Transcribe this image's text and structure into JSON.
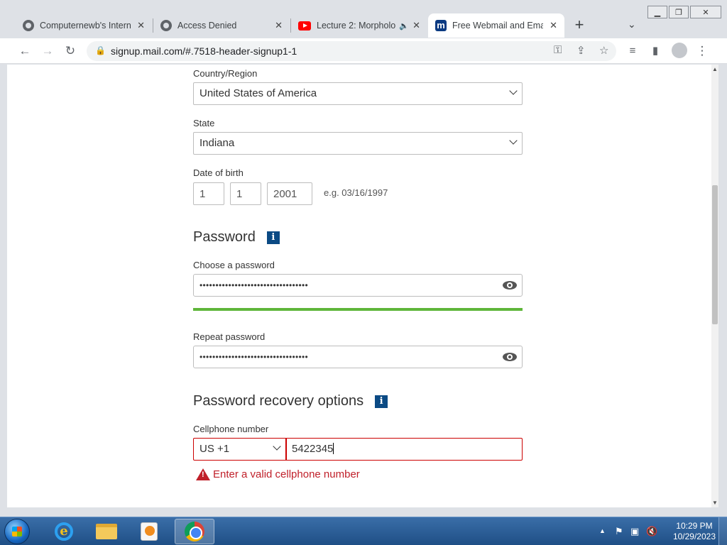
{
  "browser": {
    "tabs": [
      {
        "title": "Computernewb's Interne",
        "favicon": "generic-globe-icon"
      },
      {
        "title": "Access Denied",
        "favicon": "generic-globe-icon"
      },
      {
        "title": "Lecture 2: Morpholo",
        "favicon": "youtube-icon"
      },
      {
        "title": "Free Webmail and Emai",
        "favicon": "mail-com-icon"
      }
    ],
    "active_tab": 3,
    "favicon_mail_letter": "m",
    "url": "signup.mail.com/#.7518-header-signup1-1"
  },
  "form": {
    "country_label": "Country/Region",
    "country_value": "United States of America",
    "state_label": "State",
    "state_value": "Indiana",
    "dob_label": "Date of birth",
    "dob_month": "1",
    "dob_day": "1",
    "dob_year": "2001",
    "dob_hint": "e.g. 03/16/1997",
    "password_section": "Password",
    "choose_password_label": "Choose a password",
    "password_masked": "••••••••••••••••••••••••••••••••••",
    "password_strength": 1.0,
    "repeat_password_label": "Repeat password",
    "repeat_password_masked": "••••••••••••••••••••••••••••••••••",
    "recovery_section": "Password recovery options",
    "cellphone_label": "Cellphone number",
    "country_code": "US +1",
    "cellphone_value": "5422345",
    "error_message": "Enter a valid cellphone number",
    "info_glyph": "i",
    "colors": {
      "strength_bar": "#5fb63a",
      "error": "#c0202a",
      "info_badge": "#0b4a84"
    }
  },
  "taskbar": {
    "apps": [
      "internet-explorer-icon",
      "file-explorer-icon",
      "media-center-icon",
      "chrome-icon"
    ],
    "time": "10:29 PM",
    "date": "10/29/2023"
  }
}
